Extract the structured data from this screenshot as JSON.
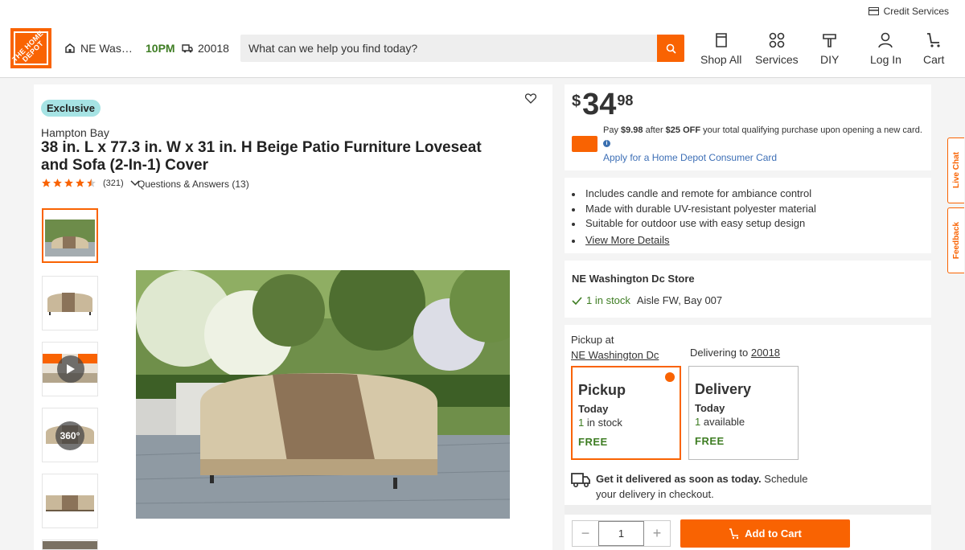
{
  "header": {
    "logo_text": "THE HOME DEPOT",
    "credit_services": "Credit Services",
    "store_name": "NE Washington Dc",
    "store_time": "10PM",
    "zip": "20018",
    "search_placeholder": "What can we help you find today?",
    "nav": [
      {
        "label": "Shop All",
        "icon": "shop-all-icon"
      },
      {
        "label": "Services",
        "icon": "services-icon"
      },
      {
        "label": "DIY",
        "icon": "diy-icon"
      },
      {
        "label": "Log In",
        "icon": "user-icon"
      },
      {
        "label": "Cart",
        "icon": "cart-icon"
      }
    ]
  },
  "product": {
    "badge": "Exclusive",
    "brand": "Hampton Bay",
    "title": "38 in. L x 77.3 in. W x 31 in. H Beige Patio Furniture Loveseat and Sofa (2-In-1) Cover",
    "rating": 4.5,
    "review_count": "(321)",
    "qa": "Questions & Answers (13)",
    "thumb_360_label": "360°"
  },
  "pricing": {
    "currency": "$",
    "dollars": "34",
    "cents": "98",
    "promo_pay": "Pay ",
    "promo_amount": "$9.98",
    "promo_after": " after ",
    "promo_off": "$25 OFF",
    "promo_rest": " your total qualifying purchase upon opening a new card.",
    "apply_link": "Apply for a Home Depot Consumer Card"
  },
  "highlights": [
    "Includes candle and remote for ambiance control",
    "Made with durable UV-resistant polyester material",
    "Suitable for outdoor use with easy setup design"
  ],
  "view_more": "View More Details",
  "store": {
    "name": "NE Washington Dc Store",
    "stock": "1 in stock",
    "aisle": "Aisle FW, Bay 007"
  },
  "fulfillment": {
    "pickup_at_label": "Pickup at",
    "pickup_store": "NE Washington Dc",
    "delivering_to_label": "Delivering to ",
    "delivering_zip": "20018",
    "pickup": {
      "title": "Pickup",
      "when": "Today",
      "qty": "1",
      "qty_text": " in stock",
      "price": "FREE"
    },
    "delivery": {
      "title": "Delivery",
      "when": "Today",
      "qty": "1",
      "qty_text": " available",
      "price": "FREE"
    },
    "msg_bold": "Get it delivered as soon as today.",
    "msg_rest": " Schedule your delivery in checkout."
  },
  "cart": {
    "quantity": "1",
    "add_to_cart": "Add to Cart"
  },
  "side_tabs": {
    "live_chat": "Live Chat",
    "feedback": "Feedback"
  },
  "colors": {
    "brand_orange": "#f96302",
    "in_stock_green": "#3e7d23",
    "link_blue": "#3d6fb6",
    "badge_teal": "#a6e3e4"
  }
}
